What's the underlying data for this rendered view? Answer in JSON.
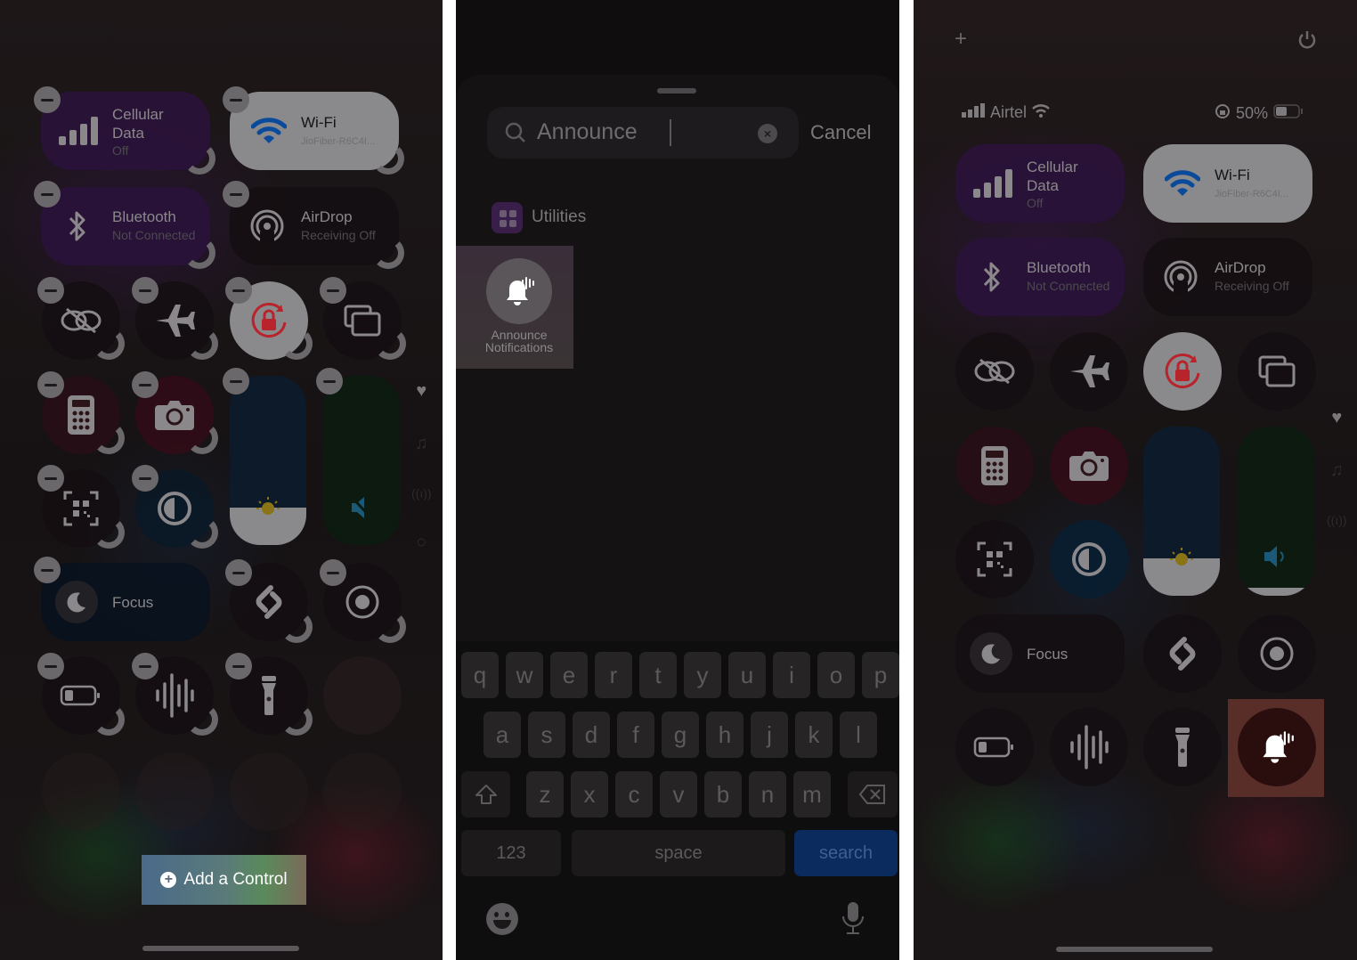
{
  "panel1": {
    "connectivity": [
      {
        "title_lines": [
          "Cellular",
          "Data"
        ],
        "subtitle": "Off",
        "icon": "cellular-signal-icon"
      },
      {
        "title_lines": [
          "Wi-Fi"
        ],
        "subtitle": "JioFiber-R6C4I...",
        "icon": "wifi-icon"
      },
      {
        "title_lines": [
          "Bluetooth"
        ],
        "subtitle": "Not Connected",
        "icon": "bluetooth-icon"
      },
      {
        "title_lines": [
          "AirDrop"
        ],
        "subtitle": "Receiving Off",
        "icon": "airdrop-icon"
      }
    ],
    "controls": [
      {
        "name": "screen-mirroring",
        "icon": "⛓"
      },
      {
        "name": "airplane-mode",
        "icon": "✈"
      },
      {
        "name": "orientation-lock",
        "icon": "🔒"
      },
      {
        "name": "stage-manager",
        "icon": "❐"
      },
      {
        "name": "calculator",
        "icon": "▦"
      },
      {
        "name": "camera",
        "icon": "📷"
      },
      {
        "name": "code-scanner",
        "icon": "▣"
      },
      {
        "name": "dark-mode",
        "icon": "◐"
      },
      {
        "name": "shazam",
        "icon": "S"
      },
      {
        "name": "screen-recording",
        "icon": "◉"
      },
      {
        "name": "low-power-mode",
        "icon": "▭"
      },
      {
        "name": "voice-memo",
        "icon": "|||"
      },
      {
        "name": "flashlight",
        "icon": "🔦"
      }
    ],
    "focus_label": "Focus",
    "brightness_level": 0.22,
    "volume_level": 0.0,
    "add_control_label": "Add a Control",
    "side_icons": [
      "heart-icon",
      "music-note-icon",
      "antenna-icon",
      "ring-icon"
    ]
  },
  "panel2": {
    "search_value": "Announce",
    "cancel_label": "Cancel",
    "category_label": "Utilities",
    "result_label_lines": [
      "Announce",
      "Notifications"
    ],
    "keyboard": {
      "row1": [
        "q",
        "w",
        "e",
        "r",
        "t",
        "y",
        "u",
        "i",
        "o",
        "p"
      ],
      "row2": [
        "a",
        "s",
        "d",
        "f",
        "g",
        "h",
        "j",
        "k",
        "l"
      ],
      "row3": [
        "z",
        "x",
        "c",
        "v",
        "b",
        "n",
        "m"
      ],
      "numbers_label": "123",
      "space_label": "space",
      "search_label": "search"
    }
  },
  "panel3": {
    "carrier": "Airtel",
    "battery_percent": "50%",
    "connectivity": [
      {
        "title_lines": [
          "Cellular",
          "Data"
        ],
        "subtitle": "Off"
      },
      {
        "title_lines": [
          "Wi-Fi"
        ],
        "subtitle": "JioFiber-R6C4I..."
      },
      {
        "title_lines": [
          "Bluetooth"
        ],
        "subtitle": "Not Connected"
      },
      {
        "title_lines": [
          "AirDrop"
        ],
        "subtitle": "Receiving Off"
      }
    ],
    "focus_label": "Focus",
    "brightness_level": 0.22,
    "volume_level": 0.05,
    "added_control": "Announce Notifications"
  },
  "colors": {
    "wifi_blue": "#0a4a9a",
    "orientation_red": "#b8242c",
    "search_key_blue": "#0b2a5e",
    "highlight": "#5a2e28"
  }
}
